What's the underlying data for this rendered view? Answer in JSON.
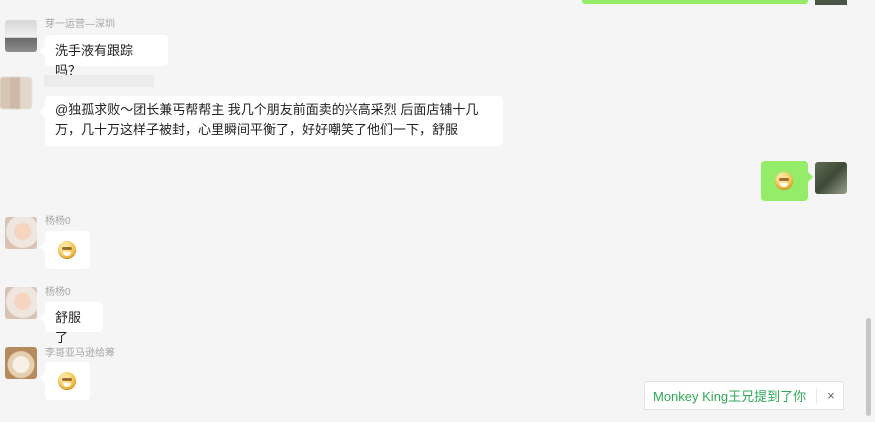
{
  "messages": [
    {
      "sender": "芽一运营—深圳",
      "text": "洗手液有跟踪吗？"
    },
    {
      "sender": "",
      "text_line1": "@独孤求败～团长兼丐帮帮主 我几个朋友前面卖的兴高采烈 后面店铺十几",
      "text_line2": "万，几十万这样子被封，心里瞬间平衡了，好好嘲笑了他们一下，舒服"
    },
    {
      "sender": "杨杨0",
      "text": "舒服了"
    },
    {
      "sender": "李哥亚马逊给筹",
      "text": ""
    }
  ],
  "self_message": {
    "type": "emoji",
    "emoji": "grin-emoji"
  },
  "mention_toast": {
    "text": "Monkey King王兄提到了你",
    "close": "×"
  },
  "colors": {
    "bubble_self": "#95ec69",
    "bubble_other": "#ffffff",
    "mention_text": "#2eaa57",
    "background": "#f5f5f5"
  }
}
